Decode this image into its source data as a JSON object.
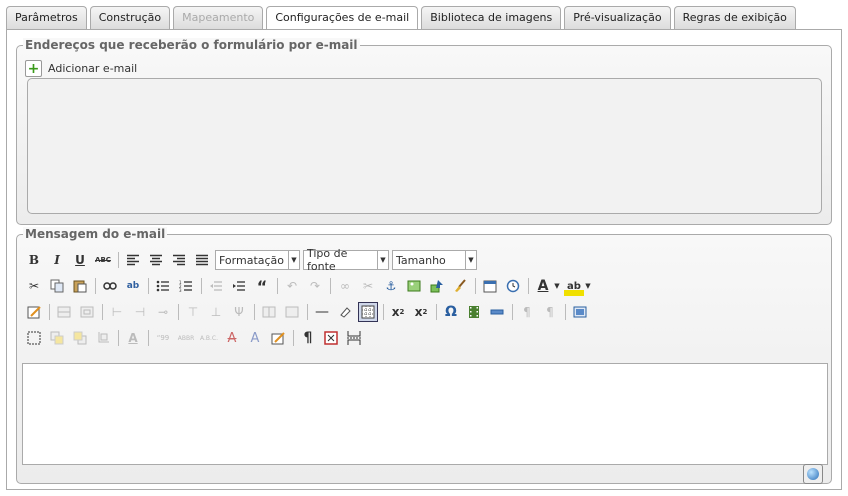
{
  "tabs": [
    {
      "label": "Parâmetros",
      "state": "normal"
    },
    {
      "label": "Construção",
      "state": "normal"
    },
    {
      "label": "Mapeamento",
      "state": "disabled"
    },
    {
      "label": "Configurações de e-mail",
      "state": "active"
    },
    {
      "label": "Biblioteca de imagens",
      "state": "normal"
    },
    {
      "label": "Pré-visualização",
      "state": "normal"
    },
    {
      "label": "Regras de exibição",
      "state": "normal"
    }
  ],
  "recipients": {
    "legend": "Endereços que receberão o formulário por e-mail",
    "add_label": "Adicionar e-mail"
  },
  "message": {
    "legend": "Mensagem do e-mail",
    "format_select": "Formatação",
    "font_select": "Tipo de fonte",
    "size_select": "Tamanho"
  },
  "colors": {
    "accent_green": "#3a9a1a",
    "border": "#aaaaaa",
    "fieldset_bg": "#f2f2f2"
  }
}
